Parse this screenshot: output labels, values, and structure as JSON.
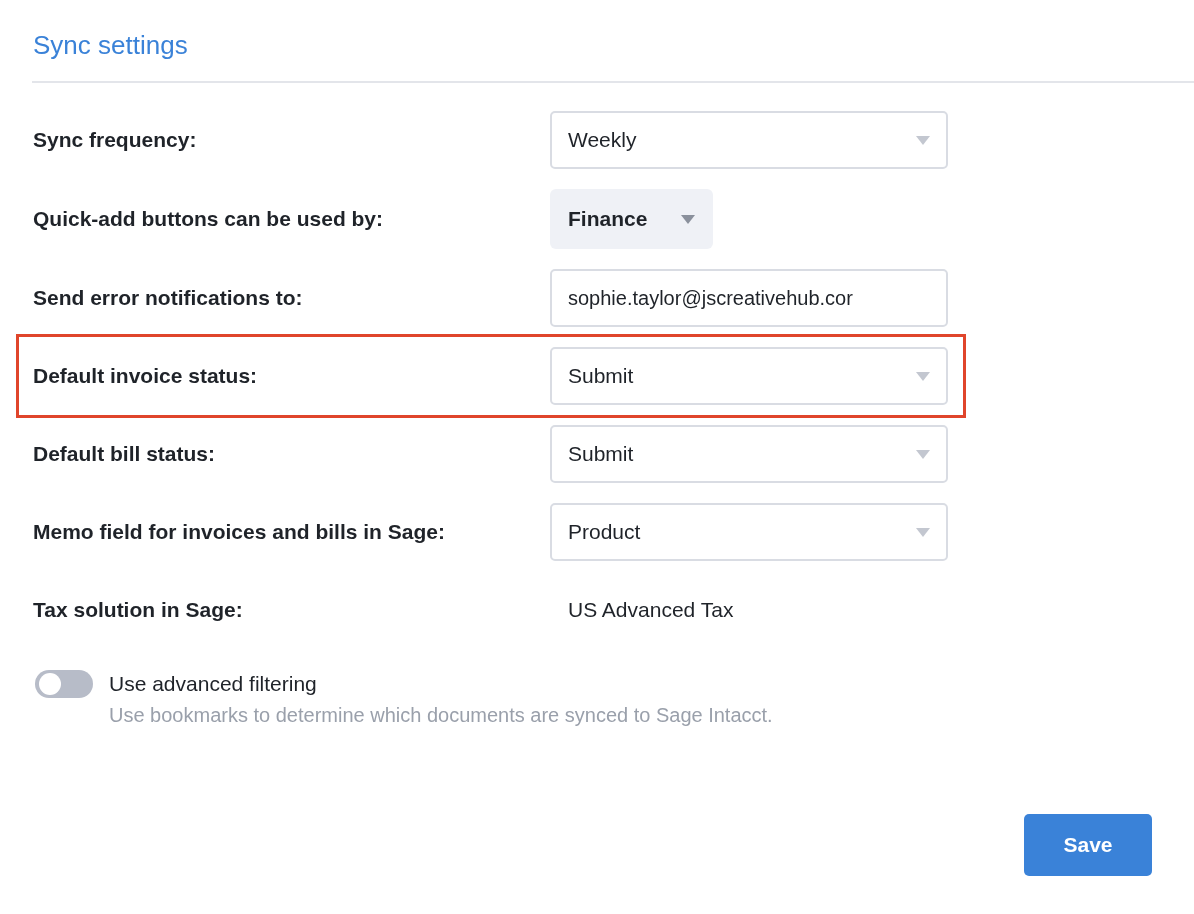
{
  "title": "Sync settings",
  "settings": [
    {
      "label": "Sync frequency:",
      "kind": "select",
      "value": "Weekly",
      "highlighted": false
    },
    {
      "label": "Quick-add buttons can be used by:",
      "kind": "menu",
      "value": "Finance",
      "highlighted": false
    },
    {
      "label": "Send error notifications to:",
      "kind": "input",
      "value": "sophie.taylor@jscreativehub.cor",
      "highlighted": false
    },
    {
      "label": "Default invoice status:",
      "kind": "select",
      "value": "Submit",
      "highlighted": true
    },
    {
      "label": "Default bill status:",
      "kind": "select",
      "value": "Submit",
      "highlighted": false
    },
    {
      "label": "Memo field for invoices and bills in Sage:",
      "kind": "select",
      "value": "Product",
      "highlighted": false
    },
    {
      "label": "Tax solution in Sage:",
      "kind": "text",
      "value": "US Advanced Tax",
      "highlighted": false
    }
  ],
  "toggle": {
    "label": "Use advanced filtering",
    "description": "Use bookmarks to determine which documents are synced to Sage Intacct.",
    "on": false
  },
  "save_button": "Save"
}
